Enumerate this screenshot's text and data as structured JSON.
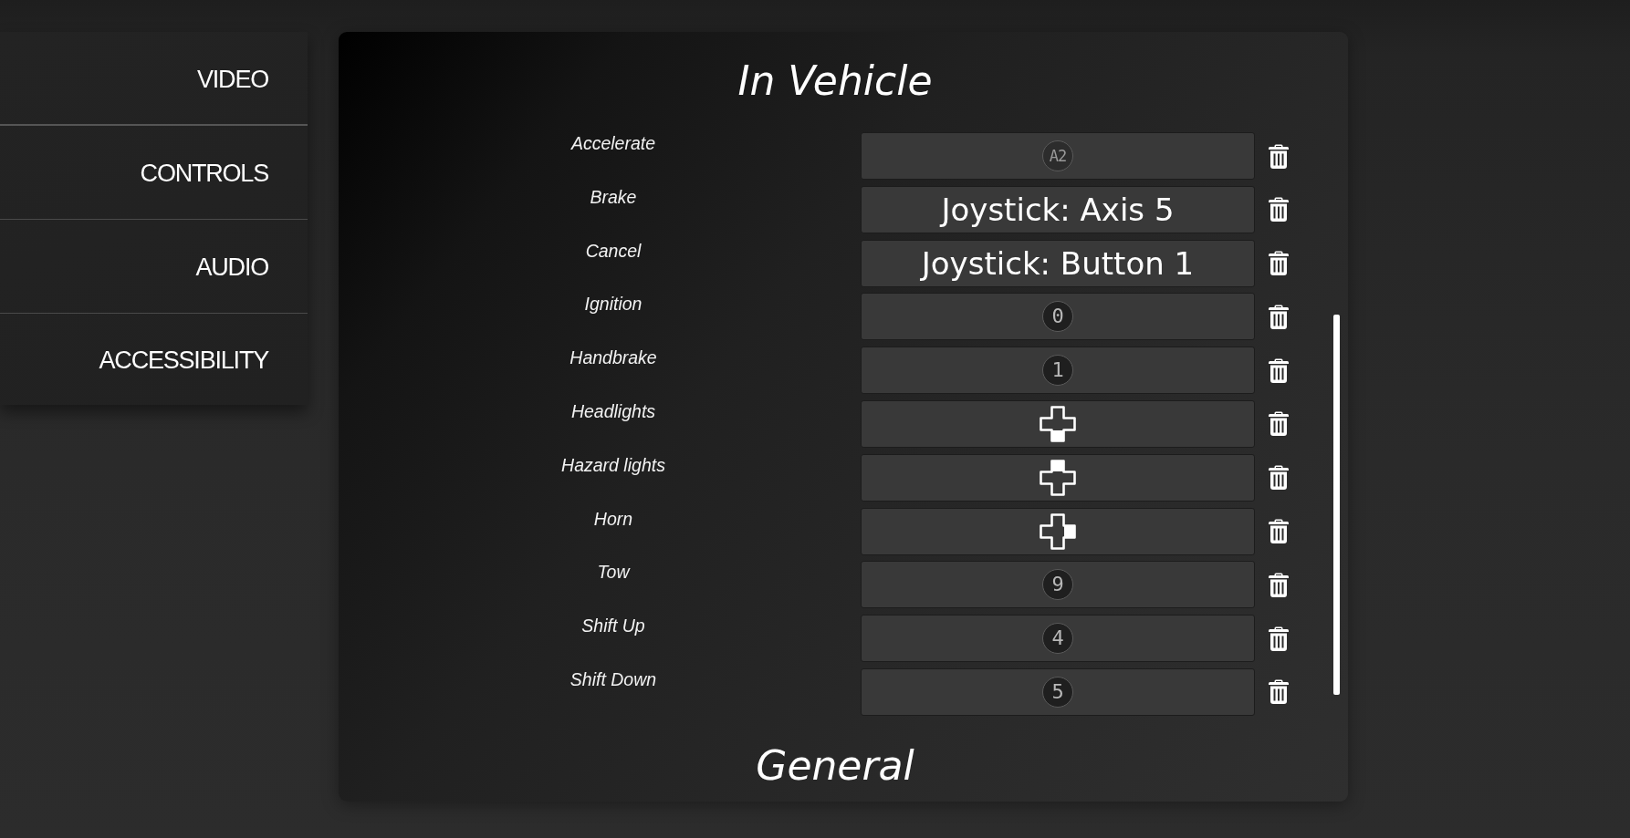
{
  "sidebar": {
    "items": [
      {
        "label": "VIDEO"
      },
      {
        "label": "CONTROLS"
      },
      {
        "label": "AUDIO"
      },
      {
        "label": "ACCESSIBILITY"
      }
    ]
  },
  "sections": [
    {
      "title": "In Vehicle",
      "bindings": [
        {
          "action": "Accelerate",
          "binding": {
            "kind": "badge",
            "text": "A2"
          }
        },
        {
          "action": "Brake",
          "binding": {
            "kind": "text",
            "text": "Joystick: Axis 5"
          }
        },
        {
          "action": "Cancel",
          "binding": {
            "kind": "text",
            "text": "Joystick: Button 1"
          }
        },
        {
          "action": "Ignition",
          "binding": {
            "kind": "badge",
            "text": "0"
          }
        },
        {
          "action": "Handbrake",
          "binding": {
            "kind": "badge",
            "text": "1"
          }
        },
        {
          "action": "Headlights",
          "binding": {
            "kind": "dpad-down"
          }
        },
        {
          "action": "Hazard lights",
          "binding": {
            "kind": "dpad-up"
          }
        },
        {
          "action": "Horn",
          "binding": {
            "kind": "dpad-right"
          }
        },
        {
          "action": "Tow",
          "binding": {
            "kind": "badge",
            "text": "9"
          }
        },
        {
          "action": "Shift Up",
          "binding": {
            "kind": "badge",
            "text": "4"
          }
        },
        {
          "action": "Shift Down",
          "binding": {
            "kind": "badge",
            "text": "5"
          }
        }
      ]
    },
    {
      "title": "General"
    }
  ]
}
